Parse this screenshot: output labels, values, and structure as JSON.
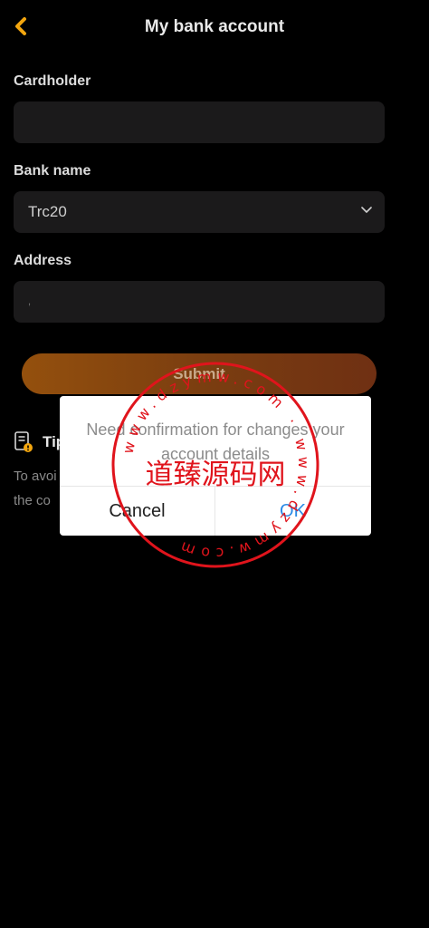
{
  "header": {
    "title": "My bank account",
    "back_icon": "chevron-left-icon"
  },
  "form": {
    "cardholder": {
      "label": "Cardholder",
      "value": ""
    },
    "bank_name": {
      "label": "Bank name",
      "value": "Trc20"
    },
    "address": {
      "label": "Address",
      "value": ","
    },
    "submit_label": "Submit"
  },
  "tips": {
    "title": "Tip",
    "text": "To avoi",
    "text_line2": "the co"
  },
  "dialog": {
    "message": "Need confirmation for changes your account details",
    "cancel_label": "Cancel",
    "ok_label": "OK"
  },
  "watermark": {
    "text": "道臻源码网",
    "ring_text": "www.dzymw.com"
  },
  "colors": {
    "accent": "#f3a60f",
    "background": "#000000",
    "field": "#1b1a1b",
    "ok": "#2a8ae6",
    "watermark": "#e0141c"
  }
}
